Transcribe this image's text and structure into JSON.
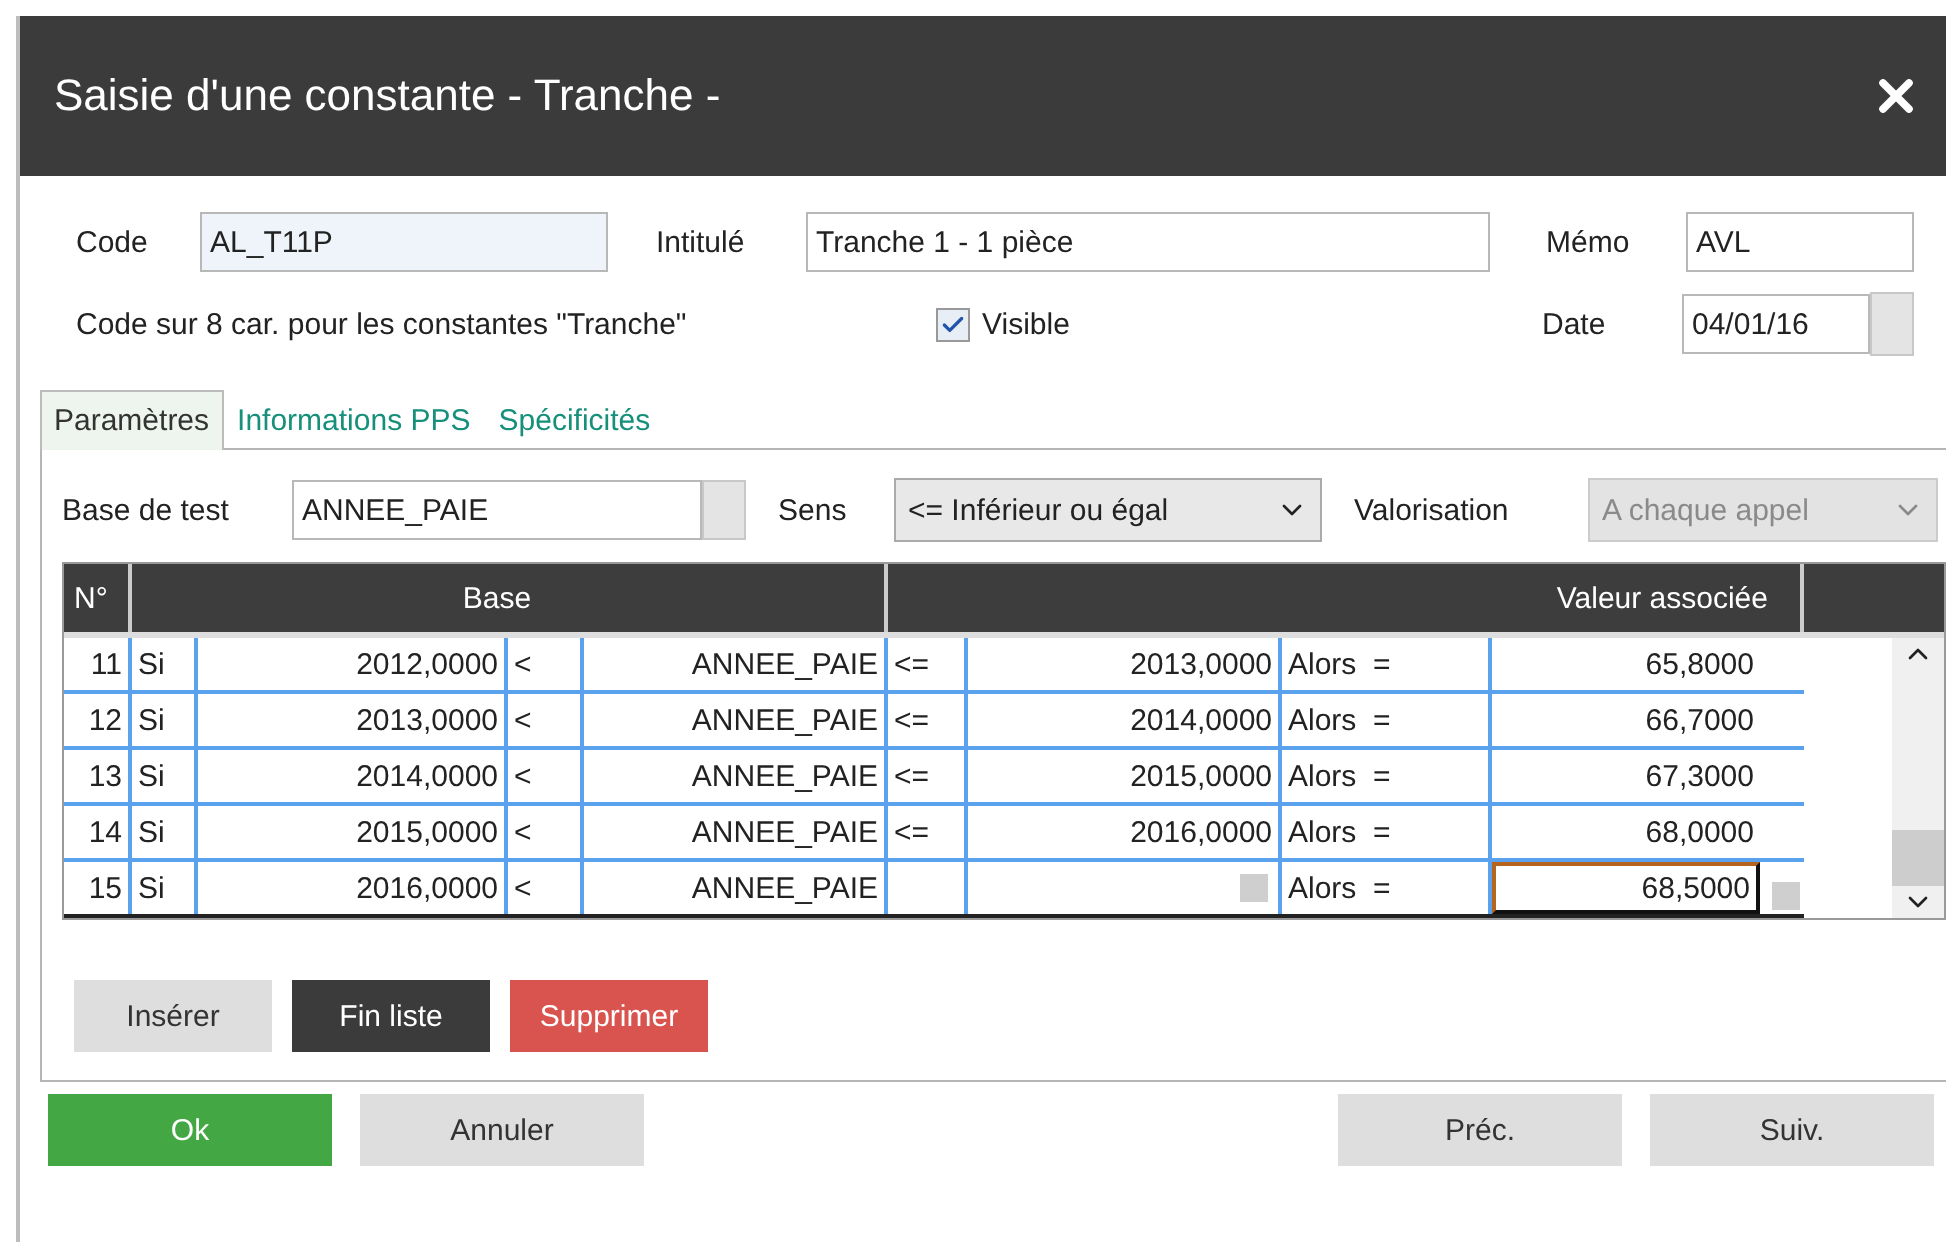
{
  "window": {
    "title": "Saisie d'une constante - Tranche -"
  },
  "header": {
    "code": {
      "label": "Code",
      "value": "AL_T11P"
    },
    "intitule": {
      "label": "Intitulé",
      "value": "Tranche 1 - 1 pièce"
    },
    "memo": {
      "label": "Mémo",
      "value": "AVL"
    },
    "hint": "Code sur 8 car. pour les constantes \"Tranche\"",
    "visible": {
      "label": "Visible",
      "checked": true
    },
    "date": {
      "label": "Date",
      "value": "04/01/16"
    }
  },
  "tabs": [
    {
      "label": "Paramètres",
      "selected": true
    },
    {
      "label": "Informations PPS",
      "selected": false
    },
    {
      "label": "Spécificités",
      "selected": false
    }
  ],
  "parameters": {
    "base_test": {
      "label": "Base de test",
      "value": "ANNEE_PAIE"
    },
    "sens": {
      "label": "Sens",
      "value": "<= Inférieur ou égal",
      "disabled": false
    },
    "valorisation": {
      "label": "Valorisation",
      "value": "A chaque appel",
      "disabled": true
    }
  },
  "grid": {
    "columns": [
      "N°",
      "Base",
      "Valeur associée"
    ],
    "rows": [
      {
        "n": "11",
        "si": "Si",
        "low": "2012,0000",
        "op1": "<",
        "base": "ANNEE_PAIE",
        "op2": "<=",
        "high": "2013,0000",
        "alors": "Alors  =",
        "value": "65,8000",
        "current": false
      },
      {
        "n": "12",
        "si": "Si",
        "low": "2013,0000",
        "op1": "<",
        "base": "ANNEE_PAIE",
        "op2": "<=",
        "high": "2014,0000",
        "alors": "Alors  =",
        "value": "66,7000",
        "current": false
      },
      {
        "n": "13",
        "si": "Si",
        "low": "2014,0000",
        "op1": "<",
        "base": "ANNEE_PAIE",
        "op2": "<=",
        "high": "2015,0000",
        "alors": "Alors  =",
        "value": "67,3000",
        "current": false
      },
      {
        "n": "14",
        "si": "Si",
        "low": "2015,0000",
        "op1": "<",
        "base": "ANNEE_PAIE",
        "op2": "<=",
        "high": "2016,0000",
        "alors": "Alors  =",
        "value": "68,0000",
        "current": false
      },
      {
        "n": "15",
        "si": "Si",
        "low": "2016,0000",
        "op1": "<",
        "base": "ANNEE_PAIE",
        "alors": "Alors  =",
        "value": "68,5000",
        "current": true
      }
    ]
  },
  "row_buttons": [
    {
      "label": "Insérer",
      "kind": "default"
    },
    {
      "label": "Fin liste",
      "kind": "dark"
    },
    {
      "label": "Supprimer",
      "kind": "danger"
    }
  ],
  "footer": {
    "left": [
      {
        "label": "Ok",
        "kind": "primary"
      },
      {
        "label": "Annuler",
        "kind": "default"
      }
    ],
    "right": [
      {
        "label": "Préc.",
        "kind": "default"
      },
      {
        "label": "Suiv.",
        "kind": "default"
      }
    ]
  }
}
